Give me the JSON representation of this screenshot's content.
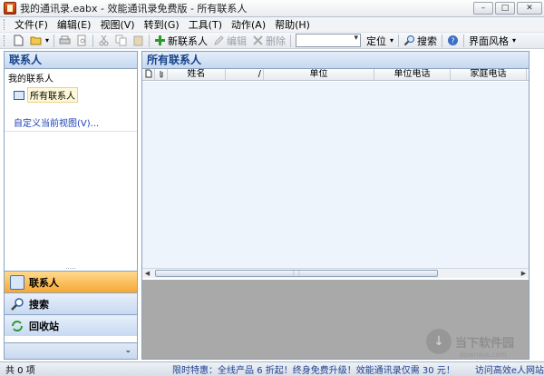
{
  "window": {
    "title": "我的通讯录.eabx - 效能通讯录免费版 - 所有联系人",
    "minimize": "–",
    "restore": "□",
    "close": "✕"
  },
  "menu": [
    "文件(F)",
    "编辑(E)",
    "视图(V)",
    "转到(G)",
    "工具(T)",
    "动作(A)",
    "帮助(H)"
  ],
  "toolbar": {
    "new_contact": "新联系人",
    "edit": "编辑",
    "delete": "删除",
    "locate": "定位",
    "search": "搜索",
    "theme": "界面风格"
  },
  "left": {
    "title": "联系人",
    "group": "我的联系人",
    "all_contacts": "所有联系人",
    "custom_view": "自定义当前视图(V)...",
    "splitter": "....."
  },
  "nav": {
    "contacts": "联系人",
    "search": "搜索",
    "recycle": "回收站",
    "footer": "⌄"
  },
  "right": {
    "title": "所有联系人",
    "columns": [
      "",
      "",
      "姓名",
      "/",
      "单位",
      "单位电话",
      "家庭电话"
    ]
  },
  "status": {
    "count": "共 0 项",
    "promo": "限时特惠：全线产品 6 折起！终身免费升级！效能通讯录仅需 30 元！",
    "link": "访问高效e人网站"
  },
  "watermark": {
    "text": "当下软件园",
    "sub": "downxia.com"
  }
}
